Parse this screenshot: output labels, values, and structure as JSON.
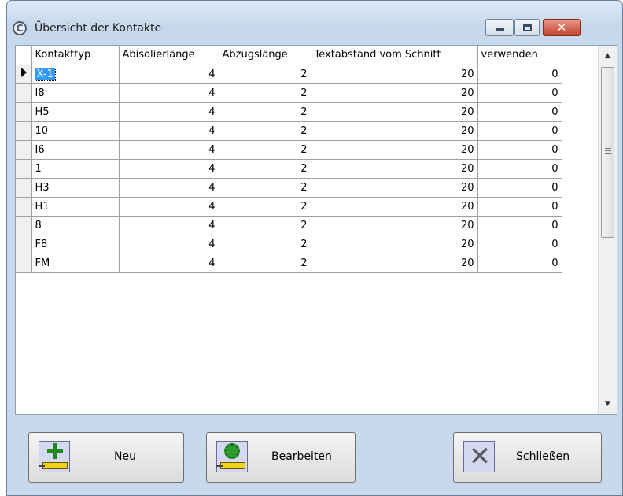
{
  "window": {
    "title": "Übersicht der Kontakte",
    "controls": {
      "minimize": "minimize-icon",
      "maximize": "maximize-icon",
      "close": "close-icon"
    }
  },
  "table": {
    "columns": [
      "Kontakttyp",
      "Abisolierlänge",
      "Abzugslänge",
      "Textabstand vom Schnitt",
      "verwenden"
    ],
    "selected_row": 0,
    "rows": [
      [
        "X-1",
        "4",
        "2",
        "20",
        "0"
      ],
      [
        "I8",
        "4",
        "2",
        "20",
        "0"
      ],
      [
        "H5",
        "4",
        "2",
        "20",
        "0"
      ],
      [
        "10",
        "4",
        "2",
        "20",
        "0"
      ],
      [
        "I6",
        "4",
        "2",
        "20",
        "0"
      ],
      [
        "1",
        "4",
        "2",
        "20",
        "0"
      ],
      [
        "H3",
        "4",
        "2",
        "20",
        "0"
      ],
      [
        "H1",
        "4",
        "2",
        "20",
        "0"
      ],
      [
        "8",
        "4",
        "2",
        "20",
        "0"
      ],
      [
        "F8",
        "4",
        "2",
        "20",
        "0"
      ],
      [
        "FM",
        "4",
        "2",
        "20",
        "0"
      ]
    ]
  },
  "buttons": {
    "new_label": "Neu",
    "edit_label": "Bearbeiten",
    "close_label": "Schließen"
  },
  "colors": {
    "selection": "#3399ff",
    "window_frame": "#c9d9ec",
    "close_button": "#c4422c"
  }
}
